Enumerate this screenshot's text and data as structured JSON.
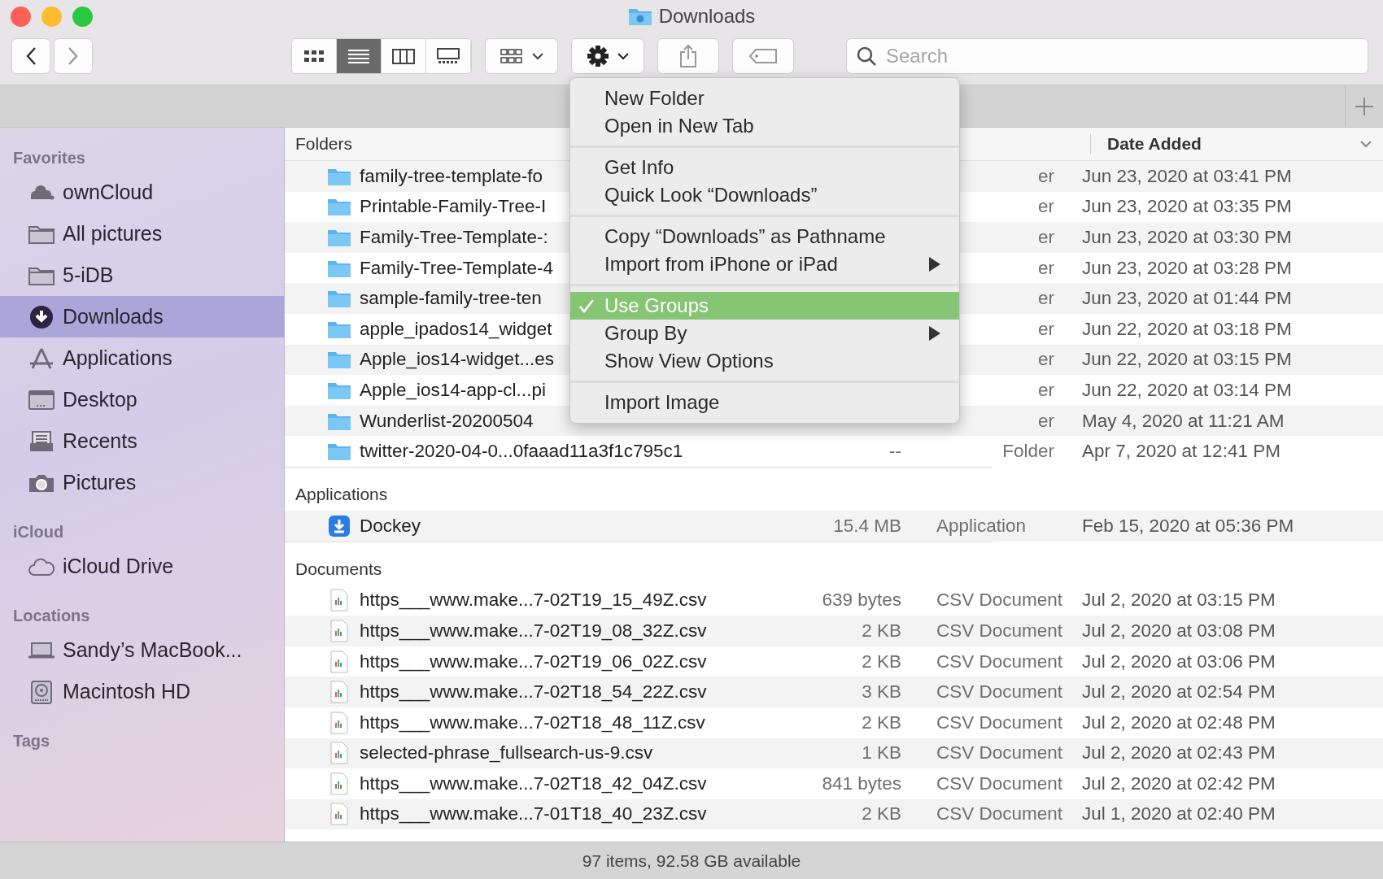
{
  "window": {
    "title": "Downloads"
  },
  "toolbar": {
    "views": [
      {
        "kind": "icons",
        "selected": false
      },
      {
        "kind": "list",
        "selected": true
      },
      {
        "kind": "columns",
        "selected": false
      },
      {
        "kind": "gallery",
        "selected": false
      }
    ],
    "search": {
      "placeholder": "Search"
    }
  },
  "sidebar": {
    "sections": [
      {
        "title": "Favorites",
        "items": [
          {
            "label": "ownCloud",
            "kind": "cloudgroup",
            "selected": false
          },
          {
            "label": "All pictures",
            "kind": "folder",
            "selected": false
          },
          {
            "label": "5-iDB",
            "kind": "folder",
            "selected": false
          },
          {
            "label": "Downloads",
            "kind": "download",
            "selected": true
          },
          {
            "label": "Applications",
            "kind": "apps",
            "selected": false
          },
          {
            "label": "Desktop",
            "kind": "display",
            "selected": false
          },
          {
            "label": "Recents",
            "kind": "tray",
            "selected": false
          },
          {
            "label": "Pictures",
            "kind": "camera",
            "selected": false
          }
        ]
      },
      {
        "title": "iCloud",
        "items": [
          {
            "label": "iCloud Drive",
            "kind": "cloud",
            "selected": false
          }
        ]
      },
      {
        "title": "Locations",
        "items": [
          {
            "label": "Sandy’s MacBook...",
            "kind": "laptop",
            "selected": false
          },
          {
            "label": "Macintosh HD",
            "kind": "disk",
            "selected": false
          }
        ]
      },
      {
        "title": "Tags"
      }
    ]
  },
  "table": {
    "date_header": "Date Added",
    "groups": [
      {
        "title": "Folders",
        "kind": "folder",
        "rows": [
          {
            "name": "family-tree-template-fo",
            "kind": "er",
            "date": "Jun 23, 2020 at 03:41 PM"
          },
          {
            "name": "Printable-Family-Tree-I",
            "kind": "er",
            "date": "Jun 23, 2020 at 03:35 PM"
          },
          {
            "name": "Family-Tree-Template-:",
            "kind": "er",
            "date": "Jun 23, 2020 at 03:30 PM"
          },
          {
            "name": "Family-Tree-Template-4",
            "kind": "er",
            "date": "Jun 23, 2020 at 03:28 PM"
          },
          {
            "name": "sample-family-tree-ten",
            "kind": "er",
            "date": "Jun 23, 2020 at 01:44 PM"
          },
          {
            "name": "apple_ipados14_widget",
            "kind": "er",
            "date": "Jun 22, 2020 at 03:18 PM"
          },
          {
            "name": "Apple_ios14-widget...es",
            "kind": "er",
            "date": "Jun 22, 2020 at 03:15 PM"
          },
          {
            "name": "Apple_ios14-app-cl...pi",
            "kind": "er",
            "date": "Jun 22, 2020 at 03:14 PM"
          },
          {
            "name": "Wunderlist-20200504",
            "kind": "er",
            "date": "May 4, 2020 at 11:21 AM"
          },
          {
            "name": "twitter-2020-04-0...0faaad11a3f1c795c1",
            "size": "--",
            "kind": "Folder",
            "date": "Apr 7, 2020 at 12:41 PM"
          }
        ]
      },
      {
        "title": "Applications",
        "kind": "app",
        "rows": [
          {
            "name": "Dockey",
            "size": "15.4 MB",
            "kind": "Application",
            "date": "Feb 15, 2020 at 05:36 PM"
          }
        ]
      },
      {
        "title": "Documents",
        "kind": "csv",
        "rows": [
          {
            "name": "https___www.make...7-02T19_15_49Z.csv",
            "size": "639 bytes",
            "kind": "CSV Document",
            "date": "Jul 2, 2020 at 03:15 PM"
          },
          {
            "name": "https___www.make...7-02T19_08_32Z.csv",
            "size": "2 KB",
            "kind": "CSV Document",
            "date": "Jul 2, 2020 at 03:08 PM"
          },
          {
            "name": "https___www.make...7-02T19_06_02Z.csv",
            "size": "2 KB",
            "kind": "CSV Document",
            "date": "Jul 2, 2020 at 03:06 PM"
          },
          {
            "name": "https___www.make...7-02T18_54_22Z.csv",
            "size": "3 KB",
            "kind": "CSV Document",
            "date": "Jul 2, 2020 at 02:54 PM"
          },
          {
            "name": "https___www.make...7-02T18_48_11Z.csv",
            "size": "2 KB",
            "kind": "CSV Document",
            "date": "Jul 2, 2020 at 02:48 PM"
          },
          {
            "name": "selected-phrase_fullsearch-us-9.csv",
            "size": "1 KB",
            "kind": "CSV Document",
            "date": "Jul 2, 2020 at 02:43 PM"
          },
          {
            "name": "https___www.make...7-02T18_42_04Z.csv",
            "size": "841 bytes",
            "kind": "CSV Document",
            "date": "Jul 2, 2020 at 02:42 PM"
          },
          {
            "name": "https___www.make...7-01T18_40_23Z.csv",
            "size": "2 KB",
            "kind": "CSV Document",
            "date": "Jul 1, 2020 at 02:40 PM"
          }
        ]
      }
    ]
  },
  "menu": {
    "sections": [
      [
        {
          "label": "New Folder",
          "checked": false,
          "selected": false,
          "submenu": false
        },
        {
          "label": "Open in New Tab",
          "checked": false,
          "selected": false,
          "submenu": false
        }
      ],
      [
        {
          "label": "Get Info",
          "checked": false,
          "selected": false,
          "submenu": false
        },
        {
          "label": "Quick Look “Downloads”",
          "checked": false,
          "selected": false,
          "submenu": false
        }
      ],
      [
        {
          "label": "Copy “Downloads” as Pathname",
          "checked": false,
          "selected": false,
          "submenu": false
        },
        {
          "label": "Import from iPhone or iPad",
          "checked": false,
          "selected": false,
          "submenu": true
        }
      ],
      [
        {
          "label": "Use Groups",
          "checked": true,
          "selected": true,
          "submenu": false
        },
        {
          "label": "Group By",
          "checked": false,
          "selected": false,
          "submenu": true
        },
        {
          "label": "Show View Options",
          "checked": false,
          "selected": false,
          "submenu": false
        }
      ],
      [
        {
          "label": "Import Image",
          "checked": false,
          "selected": false,
          "submenu": false
        }
      ]
    ]
  },
  "status_bar": {
    "text": "97 items, 92.58 GB available"
  }
}
